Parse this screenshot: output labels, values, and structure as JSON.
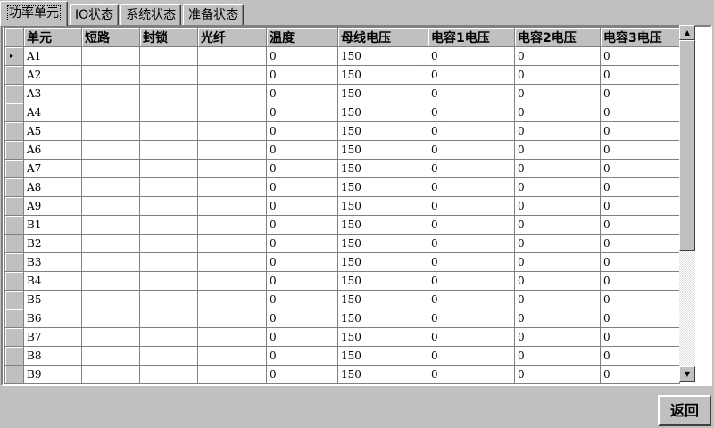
{
  "tabs": [
    "功率单元",
    "IO状态",
    "系统状态",
    "准备状态"
  ],
  "table": {
    "columns": [
      "单元",
      "短路",
      "封锁",
      "光纤",
      "温度",
      "母线电压",
      "电容1电压",
      "电容2电压",
      "电容3电压"
    ],
    "rows": [
      [
        "A1",
        "",
        "",
        "",
        "0",
        "150",
        "0",
        "0",
        "0"
      ],
      [
        "A2",
        "",
        "",
        "",
        "0",
        "150",
        "0",
        "0",
        "0"
      ],
      [
        "A3",
        "",
        "",
        "",
        "0",
        "150",
        "0",
        "0",
        "0"
      ],
      [
        "A4",
        "",
        "",
        "",
        "0",
        "150",
        "0",
        "0",
        "0"
      ],
      [
        "A5",
        "",
        "",
        "",
        "0",
        "150",
        "0",
        "0",
        "0"
      ],
      [
        "A6",
        "",
        "",
        "",
        "0",
        "150",
        "0",
        "0",
        "0"
      ],
      [
        "A7",
        "",
        "",
        "",
        "0",
        "150",
        "0",
        "0",
        "0"
      ],
      [
        "A8",
        "",
        "",
        "",
        "0",
        "150",
        "0",
        "0",
        "0"
      ],
      [
        "A9",
        "",
        "",
        "",
        "0",
        "150",
        "0",
        "0",
        "0"
      ],
      [
        "B1",
        "",
        "",
        "",
        "0",
        "150",
        "0",
        "0",
        "0"
      ],
      [
        "B2",
        "",
        "",
        "",
        "0",
        "150",
        "0",
        "0",
        "0"
      ],
      [
        "B3",
        "",
        "",
        "",
        "0",
        "150",
        "0",
        "0",
        "0"
      ],
      [
        "B4",
        "",
        "",
        "",
        "0",
        "150",
        "0",
        "0",
        "0"
      ],
      [
        "B5",
        "",
        "",
        "",
        "0",
        "150",
        "0",
        "0",
        "0"
      ],
      [
        "B6",
        "",
        "",
        "",
        "0",
        "150",
        "0",
        "0",
        "0"
      ],
      [
        "B7",
        "",
        "",
        "",
        "0",
        "150",
        "0",
        "0",
        "0"
      ],
      [
        "B8",
        "",
        "",
        "",
        "0",
        "150",
        "0",
        "0",
        "0"
      ],
      [
        "B9",
        "",
        "",
        "",
        "0",
        "150",
        "0",
        "0",
        "0"
      ]
    ],
    "current_row_indicator": "▸"
  },
  "scrollbar": {
    "up_icon": "▲",
    "down_icon": "▼",
    "up_icon_name": "scroll-up-arrow-icon",
    "down_icon_name": "scroll-down-arrow-icon"
  },
  "footer": {
    "return_label": "返回"
  }
}
